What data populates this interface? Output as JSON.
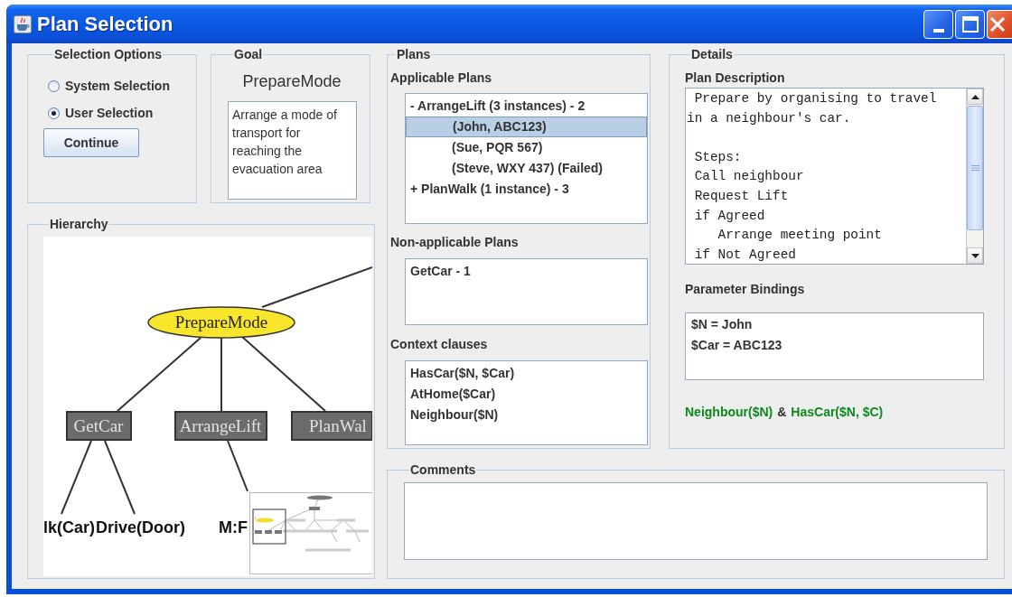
{
  "window": {
    "title": "Plan Selection"
  },
  "selection_options": {
    "title": "Selection Options",
    "options": [
      {
        "label": "System Selection",
        "selected": false
      },
      {
        "label": "User Selection",
        "selected": true
      }
    ],
    "button": "Continue"
  },
  "goal": {
    "title": "Goal",
    "name": "PrepareMode",
    "description": "Arrange a mode of transport for reaching the evacuation area"
  },
  "hierarchy": {
    "title": "Hierarchy",
    "tree": {
      "label": "PrepareMode",
      "kind": "goal",
      "children": [
        {
          "label": "GetCar",
          "kind": "plan",
          "children": [
            {
              "label": "lk(Car)",
              "kind": "action"
            },
            {
              "label": "Drive(Door)",
              "kind": "action"
            }
          ]
        },
        {
          "label": "ArrangeLift",
          "kind": "plan",
          "children": [
            {
              "label": "M:F",
              "kind": "action"
            }
          ]
        },
        {
          "label": "PlanWal",
          "kind": "plan"
        }
      ]
    }
  },
  "plans": {
    "title": "Plans",
    "applicable": {
      "title": "Applicable Plans",
      "items": [
        {
          "label": "-  ArrangeLift (3 instances) - 2",
          "selected": false,
          "children": [
            {
              "label": "(John, ABC123)",
              "selected": true
            },
            {
              "label": "(Sue, PQR 567)",
              "selected": false
            },
            {
              "label": "(Steve, WXY 437) (Failed)",
              "selected": false
            }
          ]
        },
        {
          "label": "+ PlanWalk (1 instance) - 3",
          "selected": false
        }
      ]
    },
    "non_applicable": {
      "title": "Non-applicable Plans",
      "items": [
        {
          "label": "GetCar - 1",
          "selected": false
        }
      ]
    },
    "context": {
      "title": "Context clauses",
      "items": [
        "HasCar($N, $Car)",
        "AtHome($Car)",
        "Neighbour($N)"
      ]
    }
  },
  "details": {
    "title": "Details",
    "plan_description": {
      "title": "Plan Description",
      "text": " Prepare by organising to travel\nin a neighbour's car.\n\n Steps:\n Call neighbour\n Request Lift\n if Agreed\n    Arrange meeting point\n if Not Agreed"
    },
    "parameter_bindings": {
      "title": "Parameter Bindings",
      "items": [
        "$N = John",
        "$Car = ABC123"
      ]
    },
    "condition": [
      {
        "text": "Neighbour($N)",
        "kind": "clause"
      },
      {
        "text": "&",
        "kind": "operator"
      },
      {
        "text": "HasCar($N, $C)",
        "kind": "clause"
      }
    ]
  },
  "comments": {
    "title": "Comments"
  }
}
